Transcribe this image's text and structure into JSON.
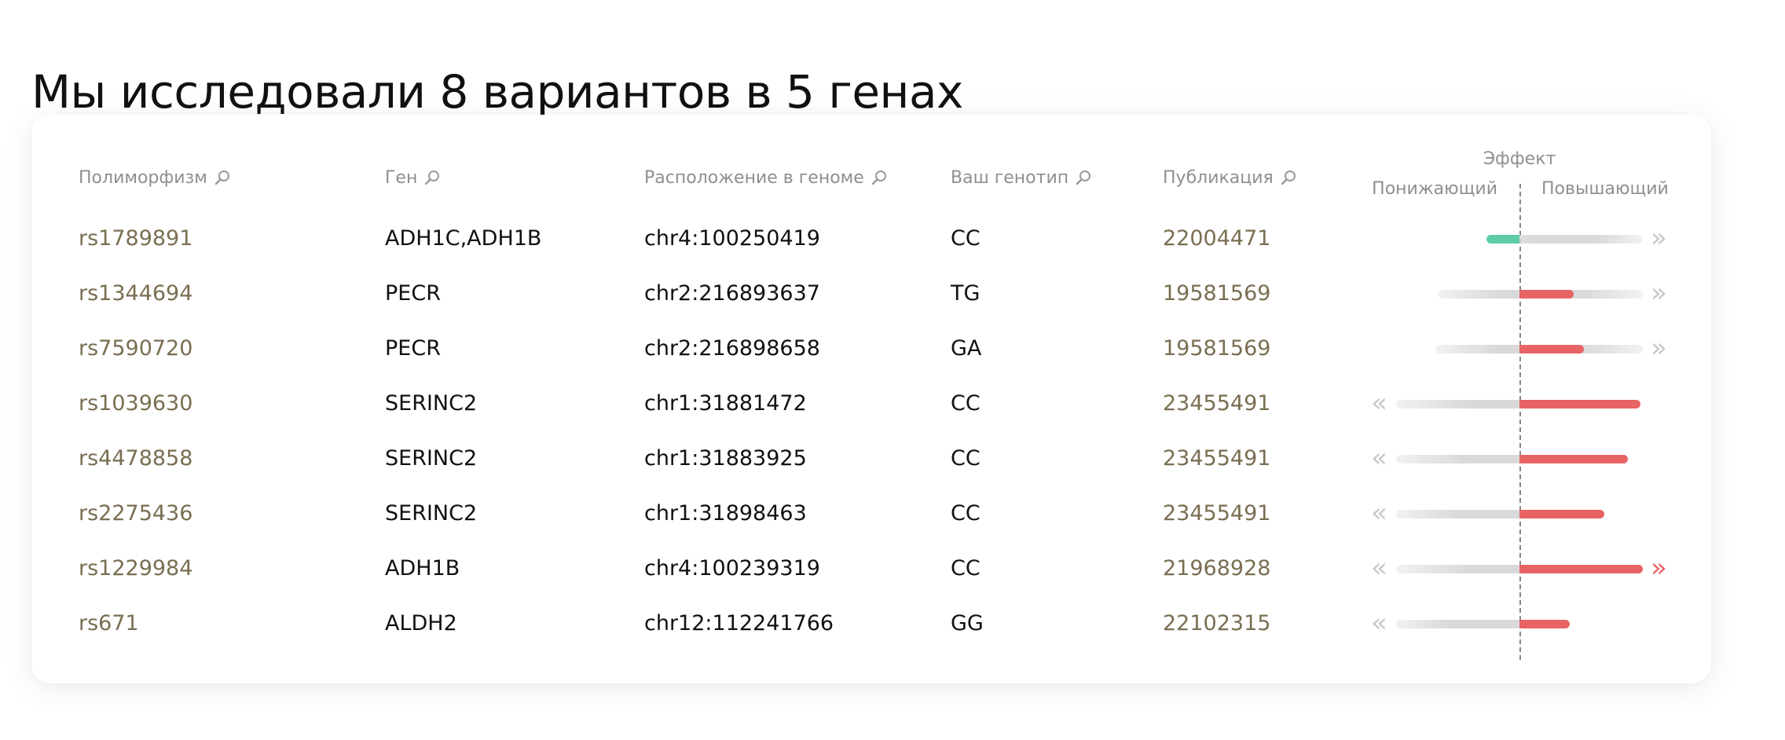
{
  "page_title": "Мы исследовали 8 вариантов в 5 генах",
  "columns": [
    {
      "key": "polymorphism",
      "label": "Полиморфизм"
    },
    {
      "key": "gene",
      "label": "Ген"
    },
    {
      "key": "location",
      "label": "Расположение в геноме"
    },
    {
      "key": "genotype",
      "label": "Ваш генотип"
    },
    {
      "key": "publication",
      "label": "Публикация"
    }
  ],
  "effect_header": {
    "title": "Эффект",
    "decreasing": "Понижающий",
    "increasing": "Повышающий"
  },
  "colors": {
    "decrease": "#5ecba9",
    "increase": "#e86464",
    "track": "#d9d9d9",
    "link": "#7a6e52"
  },
  "rows": [
    {
      "polymorphism": "rs1789891",
      "gene": "ADH1C,ADH1B",
      "location": "chr4:100250419",
      "genotype": "CC",
      "publication": "22004471",
      "effect": {
        "value": -0.27,
        "range_min": -0.27,
        "range_max": 1.0,
        "left_arrow": false,
        "right_arrow": true
      }
    },
    {
      "polymorphism": "rs1344694",
      "gene": "PECR",
      "location": "chr2:216893637",
      "genotype": "TG",
      "publication": "19581569",
      "effect": {
        "value": 0.44,
        "range_min": -0.66,
        "range_max": 1.0,
        "left_arrow": false,
        "right_arrow": true
      }
    },
    {
      "polymorphism": "rs7590720",
      "gene": "PECR",
      "location": "chr2:216898658",
      "genotype": "GA",
      "publication": "19581569",
      "effect": {
        "value": 0.52,
        "range_min": -0.68,
        "range_max": 1.0,
        "left_arrow": false,
        "right_arrow": true
      }
    },
    {
      "polymorphism": "rs1039630",
      "gene": "SERINC2",
      "location": "chr1:31881472",
      "genotype": "CC",
      "publication": "23455491",
      "effect": {
        "value": 0.98,
        "range_min": -1.0,
        "range_max": 0.98,
        "left_arrow": true,
        "right_arrow": false
      }
    },
    {
      "polymorphism": "rs4478858",
      "gene": "SERINC2",
      "location": "chr1:31883925",
      "genotype": "CC",
      "publication": "23455491",
      "effect": {
        "value": 0.88,
        "range_min": -1.0,
        "range_max": 0.88,
        "left_arrow": true,
        "right_arrow": false
      }
    },
    {
      "polymorphism": "rs2275436",
      "gene": "SERINC2",
      "location": "chr1:31898463",
      "genotype": "CC",
      "publication": "23455491",
      "effect": {
        "value": 0.69,
        "range_min": -1.0,
        "range_max": 0.69,
        "left_arrow": true,
        "right_arrow": false
      }
    },
    {
      "polymorphism": "rs1229984",
      "gene": "ADH1B",
      "location": "chr4:100239319",
      "genotype": "CC",
      "publication": "21968928",
      "effect": {
        "value": 1.0,
        "range_min": -1.0,
        "range_max": 1.0,
        "left_arrow": true,
        "right_arrow": true,
        "right_arrow_active": true
      }
    },
    {
      "polymorphism": "rs671",
      "gene": "ALDH2",
      "location": "chr12:112241766",
      "genotype": "GG",
      "publication": "22102315",
      "effect": {
        "value": 0.41,
        "range_min": -1.0,
        "range_max": 0.41,
        "left_arrow": true,
        "right_arrow": false
      }
    }
  ]
}
